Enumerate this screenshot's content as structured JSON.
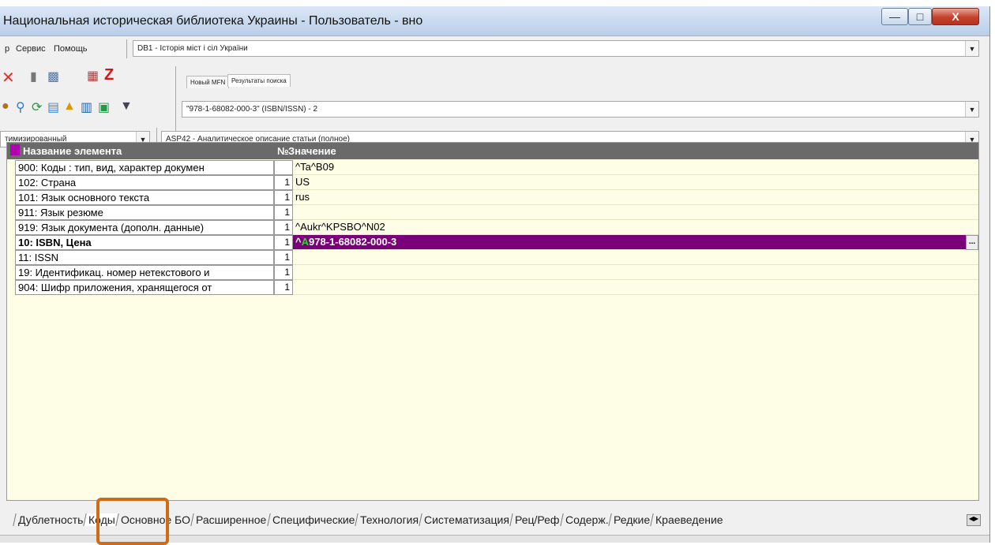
{
  "window": {
    "title": "Национальная историческая библиотека Украины - Пользователь - вно"
  },
  "menu": {
    "item_partial": "р",
    "service": "Сервис",
    "help": "Помощь"
  },
  "database_select": {
    "value": "DB1 - Історія міст і сіл України"
  },
  "tabs_mini": [
    "Новый MFN",
    "Результаты поиска"
  ],
  "search_select": {
    "value": "\"978-1-68082-000-3\" (ISBN/ISSN) - 2"
  },
  "mode_select": {
    "value": "тимизированный"
  },
  "worksheet_select": {
    "value": "ASP42 - Аналитическое описание статьи (полное)"
  },
  "grid": {
    "headers": {
      "name": "Название элемента",
      "num": "№",
      "value": "Значение"
    },
    "rows": [
      {
        "name": "900: Коды : тип, вид, характер докумен",
        "num": "",
        "value": "^Ta^B09"
      },
      {
        "name": "102: Страна",
        "num": "1",
        "value": "US"
      },
      {
        "name": "101: Язык основного текста",
        "num": "1",
        "value": "rus"
      },
      {
        "name": "911: Язык резюме",
        "num": "1",
        "value": ""
      },
      {
        "name": "919: Язык документа (дополн. данные)",
        "num": "1",
        "value": "^Aukr^KPSBO^N02"
      },
      {
        "name": "10: ISBN, Цена",
        "num": "1",
        "value_prefix": "^",
        "value_sub": "A",
        "value": "978-1-68082-000-3",
        "more": "..."
      },
      {
        "name": "11: ISSN",
        "num": "1",
        "value": ""
      },
      {
        "name": "19: Идентификац. номер нетекстового и",
        "num": "1",
        "value": ""
      },
      {
        "name": "904: Шифр приложения, хранящегося от",
        "num": "1",
        "value": ""
      }
    ]
  },
  "bottom_tabs": [
    "Дублетность",
    "Коды",
    "Основное БО",
    "Расширенное",
    "Специфические",
    "Технология",
    "Систематизация",
    "Рец/Реф",
    "Содерж.",
    "Редкие",
    "Краеведение"
  ],
  "colors": {
    "selected_row": "#7a007a",
    "highlight": "#d06a14",
    "grid_bg": "#fefee6"
  }
}
